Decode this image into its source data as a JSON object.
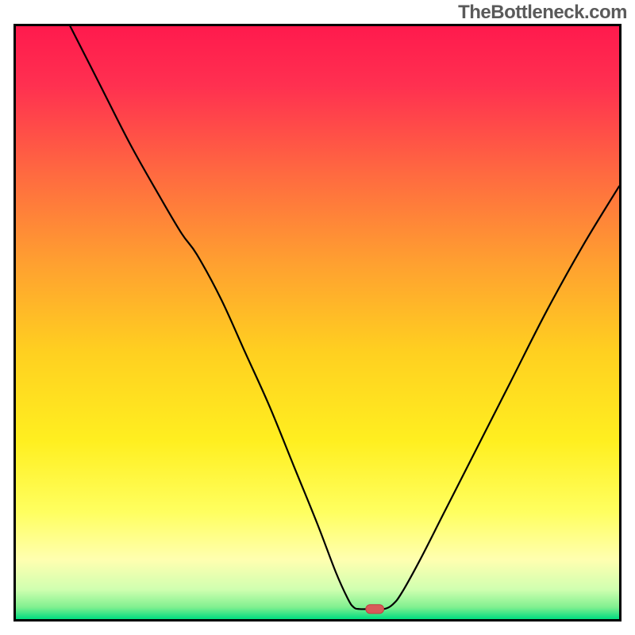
{
  "watermark": "TheBottleneck.com",
  "chart_data": {
    "type": "line",
    "title": "",
    "xlabel": "",
    "ylabel": "",
    "xlim": [
      0,
      100
    ],
    "ylim": [
      0,
      100
    ],
    "background": {
      "type": "vertical-gradient",
      "stops": [
        {
          "offset": 0.0,
          "color": "#ff1a4d"
        },
        {
          "offset": 0.1,
          "color": "#ff3050"
        },
        {
          "offset": 0.25,
          "color": "#ff6a40"
        },
        {
          "offset": 0.4,
          "color": "#ffa030"
        },
        {
          "offset": 0.55,
          "color": "#ffd020"
        },
        {
          "offset": 0.7,
          "color": "#ffef20"
        },
        {
          "offset": 0.82,
          "color": "#ffff60"
        },
        {
          "offset": 0.9,
          "color": "#ffffb0"
        },
        {
          "offset": 0.95,
          "color": "#d0ffb0"
        },
        {
          "offset": 0.98,
          "color": "#80f090"
        },
        {
          "offset": 1.0,
          "color": "#00dd80"
        }
      ]
    },
    "series": [
      {
        "name": "bottleneck-curve",
        "color": "#000000",
        "width": 2.2,
        "points": [
          {
            "x": 9.0,
            "y": 100.0
          },
          {
            "x": 14.0,
            "y": 90.0
          },
          {
            "x": 19.0,
            "y": 80.0
          },
          {
            "x": 24.0,
            "y": 71.0
          },
          {
            "x": 27.5,
            "y": 65.0
          },
          {
            "x": 30.0,
            "y": 61.5
          },
          {
            "x": 34.0,
            "y": 54.0
          },
          {
            "x": 38.0,
            "y": 45.0
          },
          {
            "x": 42.0,
            "y": 36.0
          },
          {
            "x": 46.0,
            "y": 26.0
          },
          {
            "x": 50.0,
            "y": 16.0
          },
          {
            "x": 53.0,
            "y": 8.0
          },
          {
            "x": 55.0,
            "y": 3.5
          },
          {
            "x": 56.0,
            "y": 2.0
          },
          {
            "x": 57.0,
            "y": 1.7
          },
          {
            "x": 59.0,
            "y": 1.7
          },
          {
            "x": 61.0,
            "y": 1.7
          },
          {
            "x": 62.5,
            "y": 2.5
          },
          {
            "x": 64.0,
            "y": 4.5
          },
          {
            "x": 67.0,
            "y": 10.0
          },
          {
            "x": 71.0,
            "y": 18.0
          },
          {
            "x": 76.0,
            "y": 28.0
          },
          {
            "x": 82.0,
            "y": 40.0
          },
          {
            "x": 88.0,
            "y": 52.0
          },
          {
            "x": 94.0,
            "y": 63.0
          },
          {
            "x": 100.0,
            "y": 73.0
          }
        ]
      }
    ],
    "marker": {
      "shape": "rounded-rect",
      "x": 59.5,
      "y": 1.7,
      "width_pct": 3.0,
      "height_pct": 1.5,
      "fill": "#d85a5a",
      "stroke": "#c04040"
    }
  }
}
